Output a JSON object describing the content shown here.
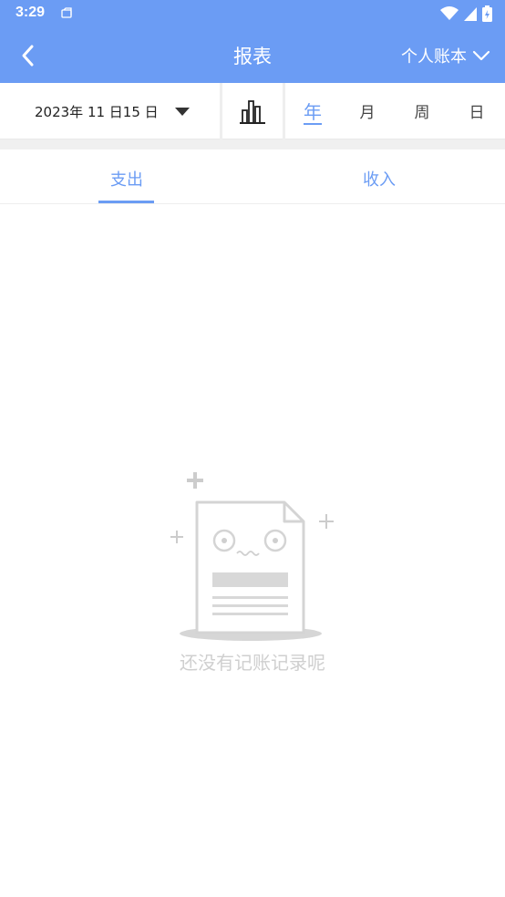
{
  "status_bar": {
    "time": "3:29",
    "icons": [
      "notification-icon",
      "wifi-icon",
      "signal-icon",
      "battery-icon"
    ]
  },
  "app_bar": {
    "title": "报表",
    "account_label": "个人账本",
    "background": "#6b9cf4"
  },
  "filter": {
    "date": "2023年 11 日15 日",
    "periods": [
      "年",
      "月",
      "周",
      "日"
    ],
    "active_period": "年"
  },
  "type_tabs": {
    "expense": "支出",
    "income": "收入",
    "active": "支出"
  },
  "empty_state": {
    "message": "还没有记账记录呢"
  },
  "colors": {
    "accent": "#6b9cf4",
    "muted_text": "#cfcfcf"
  }
}
